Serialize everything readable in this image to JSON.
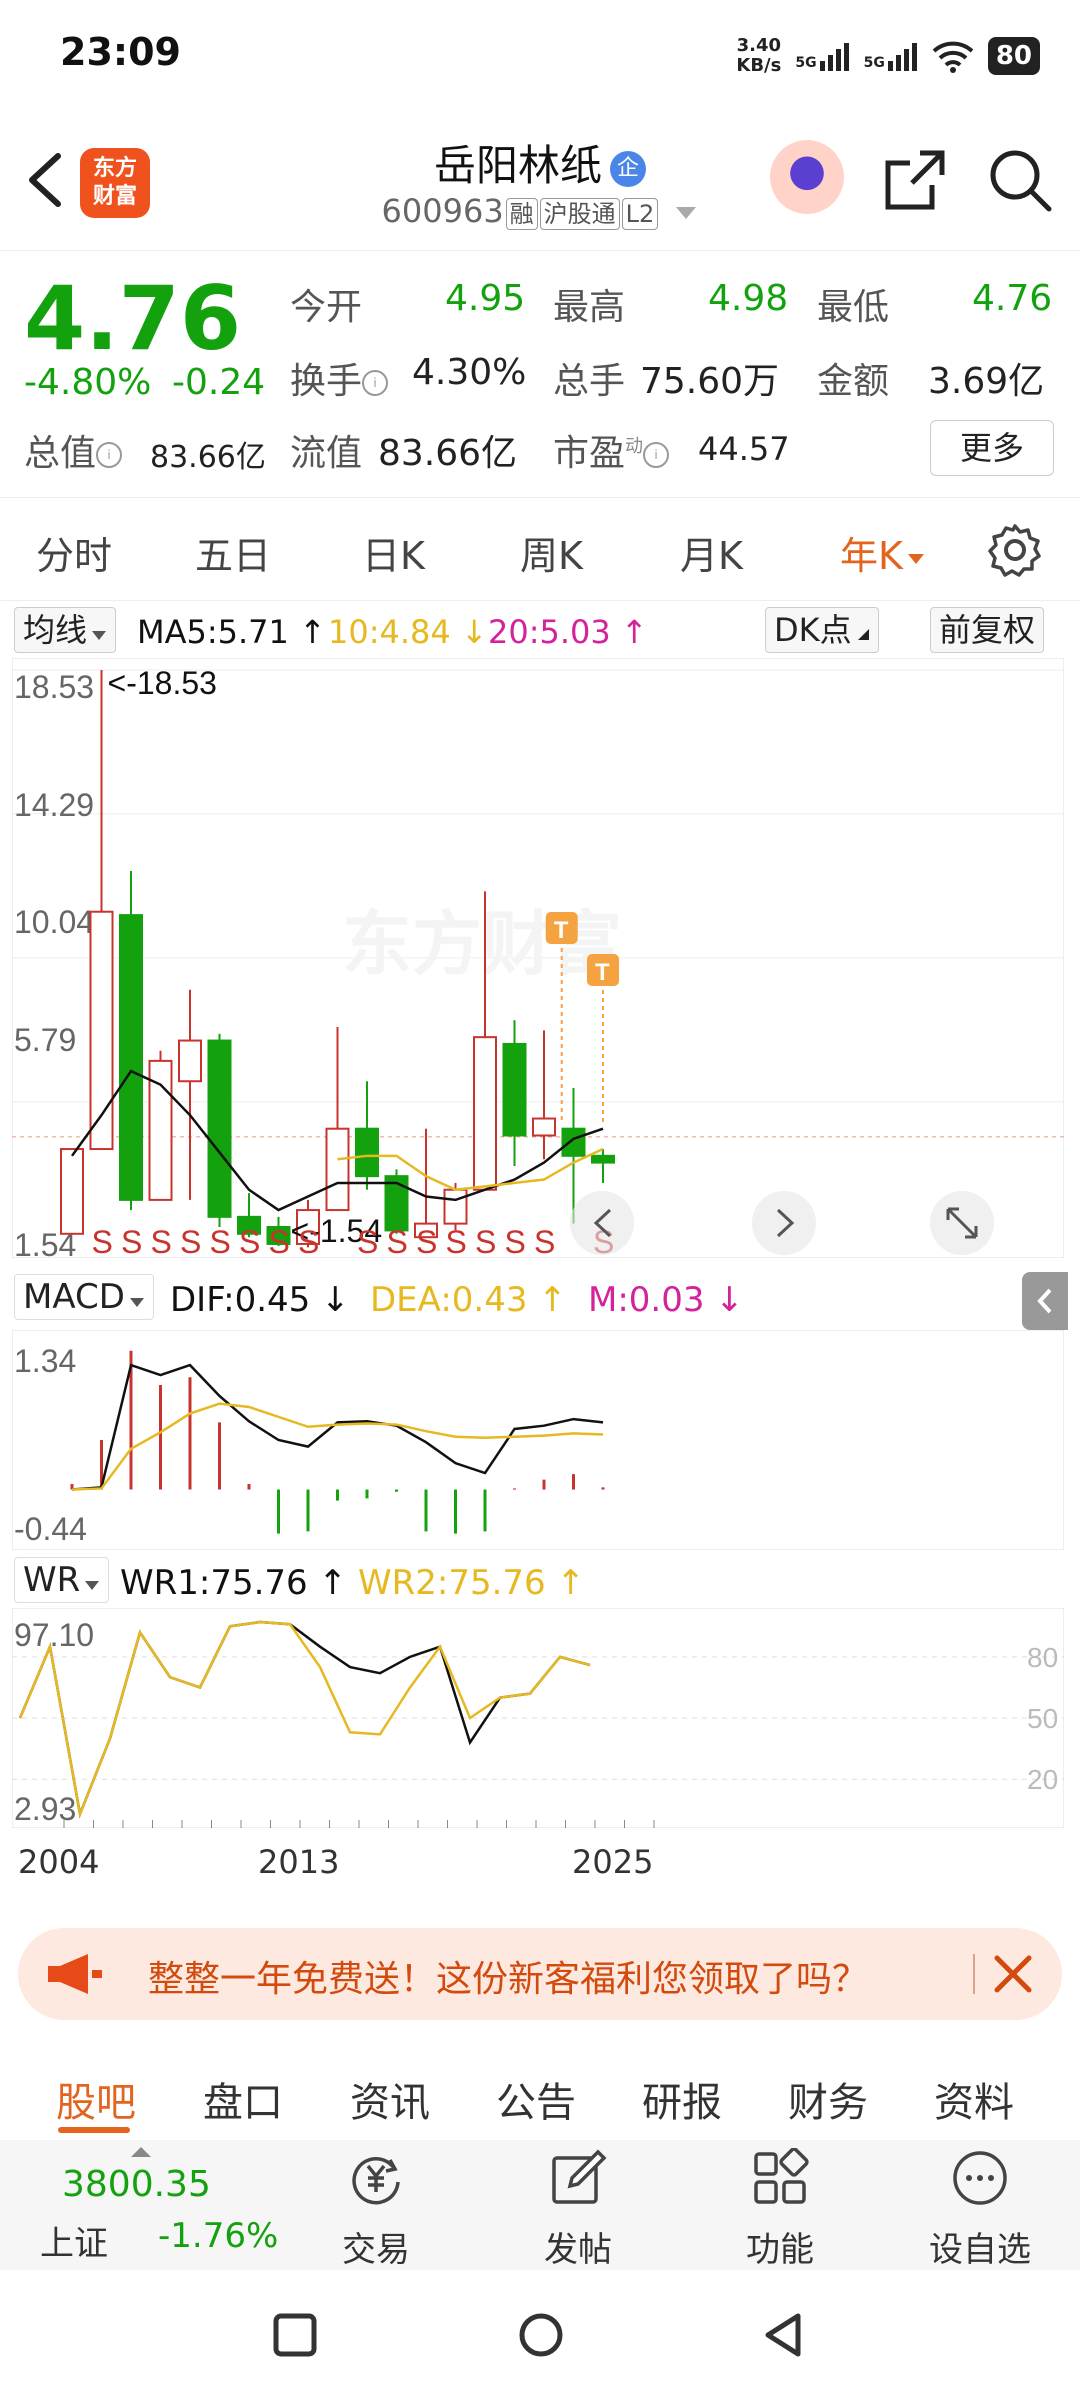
{
  "status": {
    "time": "23:09",
    "net_speed_value": "3.40",
    "net_speed_unit": "KB/s",
    "signal1": "5G",
    "signal2": "5G",
    "battery": "80"
  },
  "header": {
    "logo_line1": "东方",
    "logo_line2": "财富",
    "stock_name": "岳阳林纸",
    "verify_badge": "企",
    "stock_code": "600963",
    "tag_margin": "融",
    "tag_connect": "沪股通",
    "tag_level": "L2"
  },
  "quote": {
    "price": "4.76",
    "change_pct": "-4.80%",
    "change_val": "-0.24",
    "open_label": "今开",
    "open": "4.95",
    "high_label": "最高",
    "high": "4.98",
    "low_label": "最低",
    "low": "4.76",
    "turnover_label": "换手",
    "turnover": "4.30%",
    "volume_label": "总手",
    "volume": "75.60万",
    "amount_label": "金额",
    "amount": "3.69亿",
    "mktcap_label": "总值",
    "mktcap": "83.66亿",
    "float_label": "流值",
    "float_cap": "83.66亿",
    "pe_label": "市盈",
    "pe_super": "动",
    "pe": "44.57",
    "more": "更多"
  },
  "ktabs": [
    "分时",
    "五日",
    "日K",
    "周K",
    "月K",
    "年K"
  ],
  "ma": {
    "type_label": "均线",
    "ma5": "MA5:5.71 ↑",
    "ma10": "10:4.84 ↓",
    "ma20": "20:5.03 ↑",
    "dk_button": "DK点",
    "adjust_button": "前复权"
  },
  "macd": {
    "label": "MACD",
    "dif": "DIF:0.45 ↓",
    "dea": "DEA:0.43 ↑",
    "m": "M:0.03 ↓"
  },
  "wr": {
    "label": "WR",
    "wr1": "WR1:75.76 ↑",
    "wr2": "WR2:75.76 ↑"
  },
  "colors": {
    "up": "#c8342d",
    "down": "#13a10e",
    "ma5": "#111111",
    "ma10": "#e6b821",
    "ma20": "#d4229b",
    "accent": "#e2641e",
    "t_marker": "#f4a340"
  },
  "chart_data": [
    {
      "type": "candlestick",
      "y_ticks": [
        "18.53",
        "14.29",
        "10.04",
        "5.79",
        "1.54"
      ],
      "ylim": [
        1.54,
        18.53
      ],
      "max_label": "<-18.53",
      "min_label": "<-1.54",
      "x_ticks": [
        "2004",
        "2013",
        "2025"
      ],
      "candles": [
        {
          "o": 1.9,
          "c": 4.4,
          "h": 4.4,
          "l": 1.9,
          "up": true
        },
        {
          "o": 4.4,
          "c": 11.4,
          "h": 18.53,
          "l": 4.4,
          "up": true
        },
        {
          "o": 11.3,
          "c": 2.9,
          "h": 12.6,
          "l": 2.6,
          "up": false
        },
        {
          "o": 2.9,
          "c": 7.0,
          "h": 7.3,
          "l": 2.9,
          "up": true
        },
        {
          "o": 6.4,
          "c": 7.6,
          "h": 9.1,
          "l": 2.9,
          "up": true
        },
        {
          "o": 7.6,
          "c": 2.4,
          "h": 7.8,
          "l": 2.1,
          "up": false
        },
        {
          "o": 2.4,
          "c": 1.9,
          "h": 3.1,
          "l": 1.8,
          "up": false
        },
        {
          "o": 2.1,
          "c": 1.6,
          "h": 2.4,
          "l": 1.54,
          "up": false
        },
        {
          "o": 1.6,
          "c": 2.6,
          "h": 2.9,
          "l": 1.5,
          "up": true
        },
        {
          "o": 2.6,
          "c": 5.0,
          "h": 8.0,
          "l": 2.6,
          "up": true
        },
        {
          "o": 5.0,
          "c": 3.6,
          "h": 6.4,
          "l": 3.2,
          "up": false
        },
        {
          "o": 3.6,
          "c": 2.0,
          "h": 3.8,
          "l": 1.9,
          "up": false
        },
        {
          "o": 1.8,
          "c": 2.2,
          "h": 5.0,
          "l": 1.8,
          "up": true
        },
        {
          "o": 2.2,
          "c": 3.2,
          "h": 3.4,
          "l": 2.0,
          "up": true
        },
        {
          "o": 3.2,
          "c": 7.7,
          "h": 12.0,
          "l": 3.2,
          "up": true
        },
        {
          "o": 7.5,
          "c": 4.8,
          "h": 8.2,
          "l": 3.9,
          "up": false
        },
        {
          "o": 4.8,
          "c": 5.3,
          "h": 7.9,
          "l": 4.1,
          "up": true
        },
        {
          "o": 5.0,
          "c": 4.2,
          "h": 6.2,
          "l": 2.2,
          "up": false
        },
        {
          "o": 4.2,
          "c": 4.0,
          "h": 4.4,
          "l": 3.4,
          "up": false
        }
      ],
      "ma5": [
        4.2,
        5.4,
        6.7,
        6.3,
        5.4,
        4.3,
        3.2,
        2.6,
        3.0,
        3.4,
        3.4,
        3.4,
        3.0,
        2.9,
        3.2,
        3.5,
        4.0,
        4.7,
        5.0
      ],
      "ma10": [
        null,
        null,
        null,
        null,
        null,
        null,
        null,
        null,
        null,
        4.1,
        4.2,
        4.2,
        3.6,
        3.2,
        3.3,
        3.4,
        3.5,
        4.0,
        4.4
      ]
    },
    {
      "type": "bar",
      "name": "MACD",
      "y_ticks": [
        "1.34",
        "-0.44"
      ],
      "ylim": [
        -0.44,
        1.34
      ],
      "m_values": [
        0.05,
        0.45,
        1.26,
        0.95,
        1.02,
        0.61,
        0.05,
        -0.4,
        -0.38,
        -0.1,
        -0.08,
        -0.02,
        -0.38,
        -0.4,
        -0.38,
        0.01,
        0.09,
        0.14,
        0.02
      ],
      "dif": [
        0.0,
        0.02,
        1.13,
        1.04,
        1.13,
        0.85,
        0.62,
        0.45,
        0.39,
        0.61,
        0.62,
        0.58,
        0.43,
        0.24,
        0.15,
        0.55,
        0.58,
        0.64,
        0.61
      ],
      "dea": [
        0.0,
        0.01,
        0.37,
        0.52,
        0.69,
        0.78,
        0.75,
        0.66,
        0.57,
        0.59,
        0.6,
        0.59,
        0.53,
        0.48,
        0.47,
        0.48,
        0.49,
        0.51,
        0.5
      ]
    },
    {
      "type": "line",
      "name": "WR",
      "y_ticks": [
        "97.10",
        "2.93"
      ],
      "right_ticks": [
        "80",
        "50",
        "20"
      ],
      "ylim": [
        2.93,
        97.1
      ],
      "wr1": [
        50,
        85,
        2.93,
        40,
        92,
        70,
        65,
        95,
        97.1,
        96,
        85,
        75,
        72,
        80,
        85,
        38,
        60,
        62,
        80,
        76
      ],
      "wr2": [
        50,
        85,
        2.93,
        40,
        92,
        70,
        65,
        95,
        97.1,
        96,
        75,
        43,
        42,
        65,
        85,
        50,
        60,
        62,
        80,
        76
      ]
    }
  ],
  "promo": {
    "text": "整整一年免费送！这份新客福利您领取了吗？"
  },
  "btabs": [
    "股吧",
    "盘口",
    "资讯",
    "公告",
    "研报",
    "财务",
    "资料"
  ],
  "bottombar": {
    "index_value": "3800.35",
    "index_name": "上证",
    "index_pct": "-1.76%",
    "trade": "交易",
    "post": "发帖",
    "function": "功能",
    "watchlist": "设自选"
  }
}
